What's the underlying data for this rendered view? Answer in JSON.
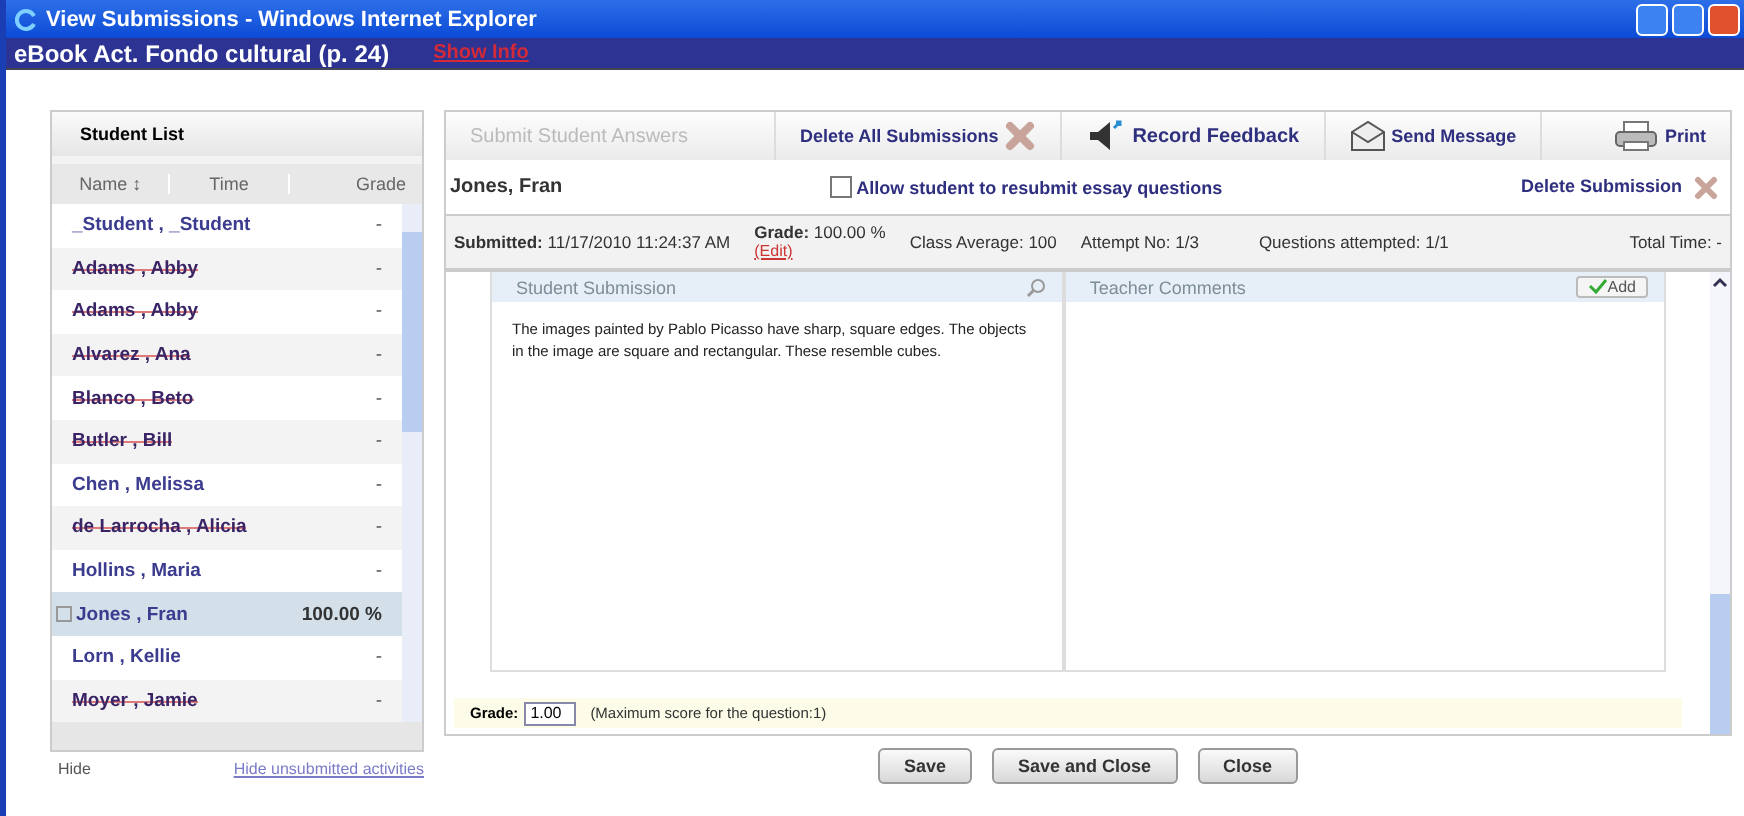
{
  "window": {
    "title": "View Submissions - Windows Internet Explorer"
  },
  "header": {
    "title": "eBook Act. Fondo cultural (p. 24)",
    "link": "Show Info"
  },
  "student_list": {
    "title": "Student List",
    "columns": [
      {
        "label": "Name ↕"
      },
      {
        "label": "Time"
      },
      {
        "label": "Grade"
      }
    ],
    "rows": [
      {
        "name": "_Student , _Student",
        "grade": "-",
        "struck": false,
        "selected": false
      },
      {
        "name": "Adams , Abby",
        "grade": "-",
        "struck": true,
        "selected": false
      },
      {
        "name": "Adams , Abby",
        "grade": "-",
        "struck": true,
        "selected": false
      },
      {
        "name": "Alvarez , Ana",
        "grade": "-",
        "struck": true,
        "selected": false
      },
      {
        "name": "Blanco , Beto",
        "grade": "-",
        "struck": true,
        "selected": false
      },
      {
        "name": "Butler , Bill",
        "grade": "-",
        "struck": true,
        "selected": false
      },
      {
        "name": "Chen , Melissa",
        "grade": "-",
        "struck": false,
        "selected": false
      },
      {
        "name": "de Larrocha , Alicia",
        "grade": "-",
        "struck": true,
        "selected": false
      },
      {
        "name": "Hollins , Maria",
        "grade": "-",
        "struck": false,
        "selected": false
      },
      {
        "name": "Jones , Fran",
        "grade": "100.00 %",
        "struck": false,
        "selected": true
      },
      {
        "name": "Lorn , Kellie",
        "grade": "-",
        "struck": false,
        "selected": false
      },
      {
        "name": "Moyer , Jamie",
        "grade": "-",
        "struck": true,
        "selected": false
      }
    ],
    "hide": "Hide",
    "hide_link": "Hide unsubmitted activities"
  },
  "toolbar": [
    {
      "kind": "disabled",
      "label": "Submit Student Answers"
    },
    {
      "kind": "delete",
      "label": "Delete All Submissions"
    },
    {
      "kind": "record",
      "label": "Record Feedback"
    },
    {
      "kind": "message",
      "label": "Send Message"
    },
    {
      "kind": "print",
      "label": "Print"
    }
  ],
  "student": {
    "name": "Jones, Fran",
    "resubmit_label": "Allow student to resubmit essay questions",
    "resubmit_checked": false,
    "delete": "Delete Submission"
  },
  "stats": {
    "submitted_label": "Submitted:",
    "submitted": "11/17/2010 11:24:37 AM",
    "grade_label": "Grade:",
    "grade": "100.00 %",
    "edit": "(Edit)",
    "class_average": "Class Average: 100",
    "attempt": "Attempt No: 1/3",
    "questions": "Questions attempted: 1/1",
    "total_time": "Total Time: -"
  },
  "submission": {
    "title": "Student Submission",
    "text": "The images painted by Pablo Picasso have sharp, square edges. The objects in the image are square and rectangular. These resemble cubes."
  },
  "comments": {
    "title": "Teacher Comments",
    "add": "Add"
  },
  "grade": {
    "label": "Grade:",
    "value": "1.00",
    "hint": "(Maximum score for the question:1)"
  },
  "buttons": [
    "Save",
    "Save and Close",
    "Close"
  ]
}
